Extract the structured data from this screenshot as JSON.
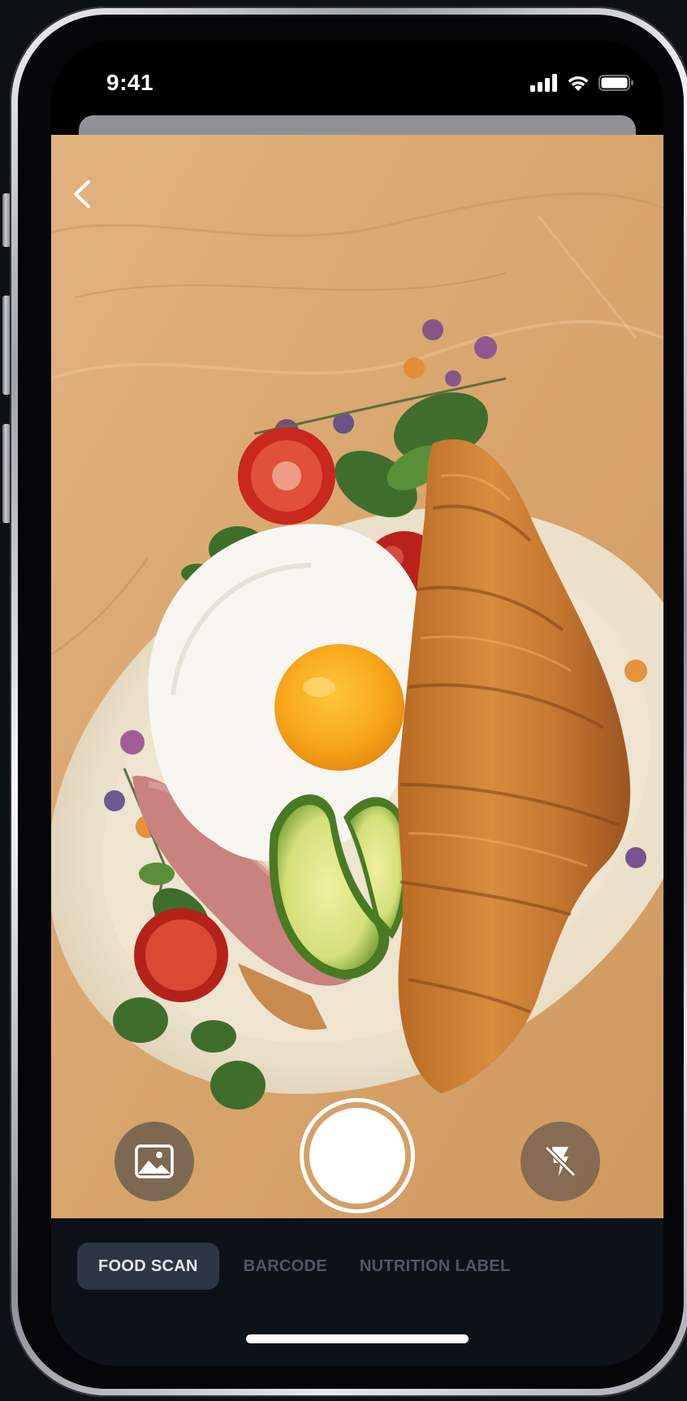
{
  "status_bar": {
    "time": "9:41",
    "icons": [
      "cellular-signal-icon",
      "wifi-icon",
      "battery-icon"
    ]
  },
  "camera": {
    "back_icon": "chevron-left-icon",
    "gallery_icon": "image-gallery-icon",
    "shutter_icon": "shutter-button",
    "flash_icon": "flash-off-icon"
  },
  "mode_tabs": [
    {
      "label": "FOOD SCAN",
      "active": true
    },
    {
      "label": "BARCODE",
      "active": false
    },
    {
      "label": "NUTRITION LABEL",
      "active": false
    }
  ],
  "colors": {
    "background": "#0c1116",
    "mode_bar": "#0d1219",
    "active_tab_bg": "#2d3644",
    "active_tab_text": "#e6e9ee",
    "inactive_tab_text": "#4f5866"
  }
}
